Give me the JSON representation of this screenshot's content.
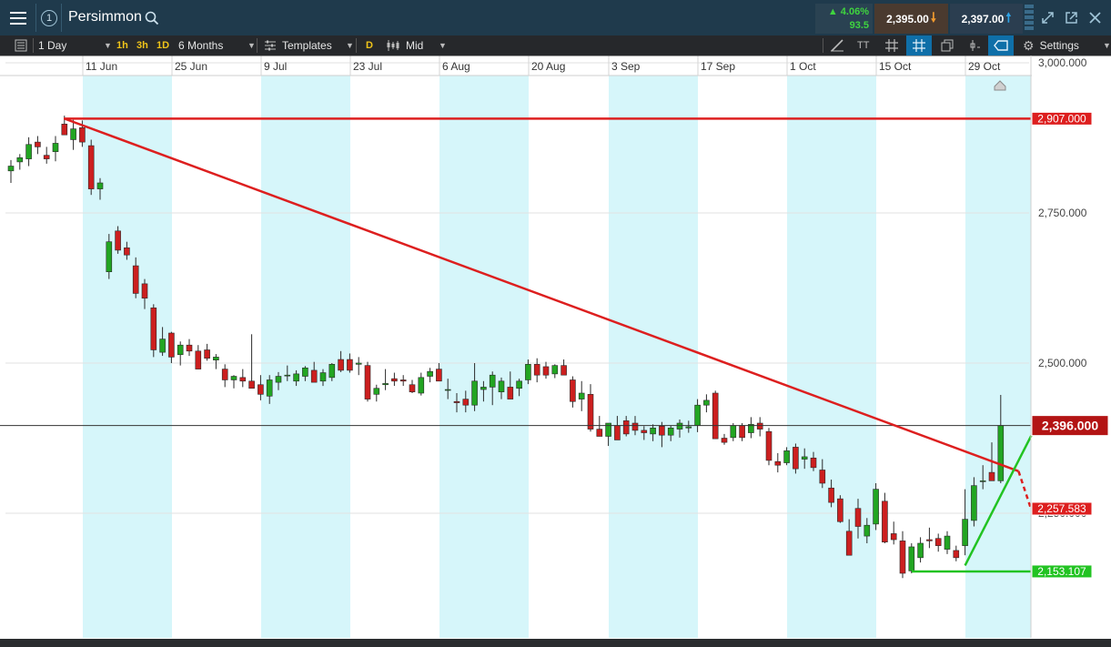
{
  "app": {
    "instrument": "Persimmon",
    "badge": "1"
  },
  "quote": {
    "change_pct": "4.06%",
    "change_pts": "93.5",
    "sell": "2,395.00",
    "buy": "2,397.00"
  },
  "toolbar": {
    "interval": "1 Day",
    "btn_1h": "1h",
    "btn_3h": "3h",
    "btn_1d": "1D",
    "range": "6 Months",
    "templates": "Templates",
    "d_btn": "D",
    "price_mode": "Mid",
    "text_tool": "TT",
    "settings": "Settings"
  },
  "chart_data": {
    "type": "candlestick",
    "title": "Persimmon",
    "x_labels": [
      "11 Jun",
      "25 Jun",
      "9 Jul",
      "23 Jul",
      "6 Aug",
      "20 Aug",
      "3 Sep",
      "17 Sep",
      "1 Oct",
      "15 Oct",
      "29 Oct"
    ],
    "y_ticks": [
      "3,000.000",
      "2,750.000",
      "2,500.000",
      "2,250.000"
    ],
    "price_labels": [
      {
        "value": "2,907.000",
        "color": "#dd1f1f"
      },
      {
        "value": "2,396.000",
        "color": "#b31414"
      },
      {
        "value": "2,257.583",
        "color": "#dd1f1f"
      },
      {
        "value": "2,153.107",
        "color": "#22c322"
      }
    ],
    "last_price": 2396,
    "resistance": 2907,
    "support": 2153.107,
    "candles": [
      [
        2820,
        2838,
        2800,
        2828
      ],
      [
        2835,
        2848,
        2822,
        2842
      ],
      [
        2840,
        2876,
        2828,
        2864
      ],
      [
        2868,
        2878,
        2848,
        2860
      ],
      [
        2846,
        2860,
        2832,
        2840
      ],
      [
        2852,
        2878,
        2836,
        2866
      ],
      [
        2898,
        2912,
        2880,
        2880
      ],
      [
        2872,
        2905,
        2855,
        2890
      ],
      [
        2892,
        2904,
        2860,
        2868
      ],
      [
        2862,
        2872,
        2780,
        2790
      ],
      [
        2790,
        2808,
        2772,
        2800
      ],
      [
        2652,
        2715,
        2640,
        2702
      ],
      [
        2720,
        2728,
        2682,
        2688
      ],
      [
        2692,
        2702,
        2672,
        2680
      ],
      [
        2662,
        2676,
        2608,
        2616
      ],
      [
        2632,
        2640,
        2590,
        2608
      ],
      [
        2592,
        2598,
        2510,
        2522
      ],
      [
        2518,
        2560,
        2512,
        2540
      ],
      [
        2550,
        2552,
        2500,
        2510
      ],
      [
        2514,
        2536,
        2496,
        2530
      ],
      [
        2530,
        2540,
        2512,
        2520
      ],
      [
        2520,
        2530,
        2490,
        2490
      ],
      [
        2522,
        2532,
        2504,
        2508
      ],
      [
        2505,
        2515,
        2490,
        2510
      ],
      [
        2490,
        2498,
        2460,
        2472
      ],
      [
        2472,
        2480,
        2458,
        2478
      ],
      [
        2476,
        2490,
        2460,
        2470
      ],
      [
        2470,
        2548,
        2458,
        2458
      ],
      [
        2464,
        2480,
        2438,
        2448
      ],
      [
        2445,
        2480,
        2432,
        2472
      ],
      [
        2468,
        2485,
        2455,
        2478
      ],
      [
        2480,
        2496,
        2470,
        2480
      ],
      [
        2470,
        2488,
        2462,
        2482
      ],
      [
        2478,
        2495,
        2470,
        2492
      ],
      [
        2488,
        2502,
        2474,
        2468
      ],
      [
        2470,
        2490,
        2462,
        2484
      ],
      [
        2476,
        2500,
        2470,
        2498
      ],
      [
        2506,
        2520,
        2485,
        2488
      ],
      [
        2506,
        2516,
        2484,
        2488
      ],
      [
        2498,
        2510,
        2480,
        2500
      ],
      [
        2496,
        2502,
        2436,
        2440
      ],
      [
        2448,
        2464,
        2436,
        2458
      ],
      [
        2464,
        2490,
        2455,
        2466
      ],
      [
        2474,
        2484,
        2462,
        2470
      ],
      [
        2472,
        2480,
        2462,
        2470
      ],
      [
        2464,
        2472,
        2450,
        2452
      ],
      [
        2450,
        2484,
        2446,
        2476
      ],
      [
        2478,
        2492,
        2468,
        2486
      ],
      [
        2490,
        2500,
        2474,
        2470
      ],
      [
        2456,
        2474,
        2440,
        2456
      ],
      [
        2436,
        2450,
        2418,
        2434
      ],
      [
        2440,
        2454,
        2418,
        2430
      ],
      [
        2430,
        2500,
        2420,
        2470
      ],
      [
        2456,
        2470,
        2436,
        2460
      ],
      [
        2460,
        2486,
        2430,
        2480
      ],
      [
        2452,
        2476,
        2440,
        2470
      ],
      [
        2460,
        2486,
        2444,
        2440
      ],
      [
        2458,
        2474,
        2445,
        2470
      ],
      [
        2472,
        2506,
        2465,
        2498
      ],
      [
        2498,
        2508,
        2468,
        2480
      ],
      [
        2494,
        2502,
        2474,
        2480
      ],
      [
        2482,
        2498,
        2475,
        2496
      ],
      [
        2496,
        2506,
        2482,
        2480
      ],
      [
        2472,
        2478,
        2426,
        2436
      ],
      [
        2440,
        2470,
        2420,
        2450
      ],
      [
        2448,
        2465,
        2386,
        2390
      ],
      [
        2390,
        2412,
        2378,
        2378
      ],
      [
        2378,
        2392,
        2362,
        2400
      ],
      [
        2396,
        2412,
        2374,
        2372
      ],
      [
        2404,
        2412,
        2378,
        2382
      ],
      [
        2400,
        2412,
        2380,
        2388
      ],
      [
        2388,
        2395,
        2372,
        2384
      ],
      [
        2382,
        2398,
        2370,
        2392
      ],
      [
        2395,
        2402,
        2360,
        2380
      ],
      [
        2380,
        2396,
        2370,
        2392
      ],
      [
        2390,
        2406,
        2376,
        2400
      ],
      [
        2392,
        2404,
        2384,
        2394
      ],
      [
        2396,
        2440,
        2385,
        2430
      ],
      [
        2430,
        2448,
        2418,
        2438
      ],
      [
        2450,
        2454,
        2374,
        2374
      ],
      [
        2375,
        2382,
        2364,
        2368
      ],
      [
        2376,
        2400,
        2370,
        2396
      ],
      [
        2396,
        2400,
        2370,
        2376
      ],
      [
        2384,
        2410,
        2375,
        2398
      ],
      [
        2400,
        2410,
        2378,
        2390
      ],
      [
        2386,
        2392,
        2330,
        2338
      ],
      [
        2336,
        2350,
        2318,
        2330
      ],
      [
        2334,
        2360,
        2330,
        2354
      ],
      [
        2360,
        2366,
        2316,
        2324
      ],
      [
        2340,
        2358,
        2324,
        2344
      ],
      [
        2342,
        2352,
        2320,
        2326
      ],
      [
        2322,
        2340,
        2292,
        2300
      ],
      [
        2292,
        2306,
        2260,
        2268
      ],
      [
        2274,
        2280,
        2234,
        2236
      ],
      [
        2220,
        2240,
        2180,
        2180
      ],
      [
        2258,
        2274,
        2208,
        2228
      ],
      [
        2212,
        2242,
        2200,
        2230
      ],
      [
        2232,
        2300,
        2222,
        2290
      ],
      [
        2270,
        2284,
        2200,
        2202
      ],
      [
        2216,
        2236,
        2198,
        2206
      ],
      [
        2204,
        2220,
        2142,
        2150
      ],
      [
        2154,
        2200,
        2150,
        2194
      ],
      [
        2176,
        2210,
        2168,
        2200
      ],
      [
        2206,
        2226,
        2192,
        2204
      ],
      [
        2208,
        2216,
        2186,
        2196
      ],
      [
        2190,
        2220,
        2182,
        2212
      ],
      [
        2188,
        2196,
        2170,
        2176
      ],
      [
        2196,
        2290,
        2180,
        2240
      ],
      [
        2238,
        2310,
        2228,
        2296
      ],
      [
        2304,
        2330,
        2290,
        2304
      ],
      [
        2318,
        2368,
        2306,
        2304
      ],
      [
        2304,
        2447,
        2300,
        2396
      ]
    ],
    "trendlines": [
      {
        "from": [
          6,
          2907
        ],
        "to": [
          113,
          2320
        ],
        "extend_to": [
          115,
          2257.583
        ],
        "color": "#dd1f1f"
      },
      {
        "from": [
          107,
          2163
        ],
        "to": [
          115,
          2396
        ],
        "color": "#22c322"
      }
    ],
    "y_range": [
      2100,
      3050
    ]
  }
}
